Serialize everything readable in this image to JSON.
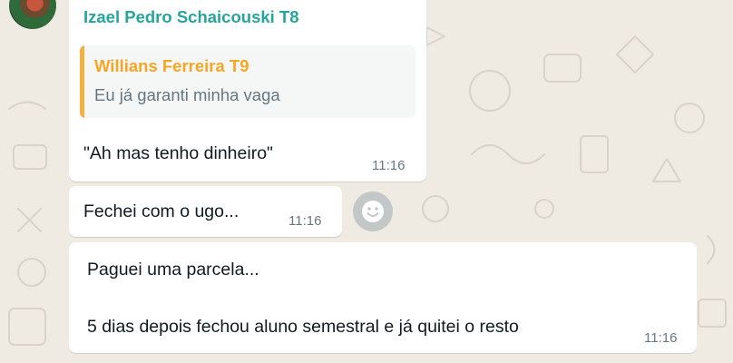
{
  "chat": {
    "sender_name": "Izael Pedro Schaicouski T8",
    "messages": [
      {
        "quoted_author": "Willians Ferreira T9",
        "quoted_text": "Eu já garanti minha vaga",
        "text": "\"Ah mas tenho dinheiro\"",
        "time": "11:16"
      },
      {
        "text": "Fechei com o ugo...",
        "time": "11:16"
      },
      {
        "line1": "Paguei uma parcela...",
        "line2": "5 dias depois fechou aluno semestral e já quitei o resto",
        "time": "11:16"
      }
    ]
  },
  "colors": {
    "sender": "#26a69a",
    "quoted_author": "#f5a623",
    "quote_bar": "#f5b041",
    "background": "#efeae2"
  },
  "icons": {
    "avatar": "avatar-photo",
    "reaction": "smiley-face-icon"
  }
}
